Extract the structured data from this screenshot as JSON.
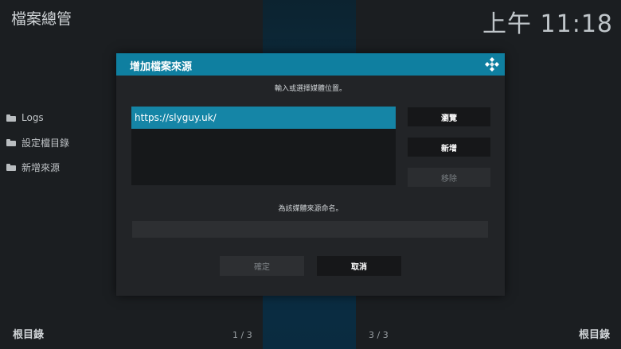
{
  "app": {
    "title": "檔案總管",
    "clock": "上午 11:18"
  },
  "sidebar": {
    "items": [
      {
        "label": "Logs",
        "icon": "folder-icon"
      },
      {
        "label": "設定檔目錄",
        "icon": "folder-icon"
      },
      {
        "label": "新增來源",
        "icon": "folder-icon"
      }
    ]
  },
  "footer": {
    "left": "根目錄",
    "right": "根目錄",
    "page_a": "1 / 3",
    "page_b": "3 / 3"
  },
  "dialog": {
    "title": "增加檔案來源",
    "path_prompt": "輸入或選擇媒體位置。",
    "paths": [
      "https://slyguy.uk/"
    ],
    "buttons": {
      "browse": "瀏覽",
      "add": "新增",
      "remove": "移除"
    },
    "name_prompt": "為該媒體來源命名。",
    "name_value": "",
    "ok": "確定",
    "cancel": "取消"
  },
  "colors": {
    "accent": "#0f7fa0",
    "selected": "#1585a6",
    "background": "#1b1e21"
  }
}
